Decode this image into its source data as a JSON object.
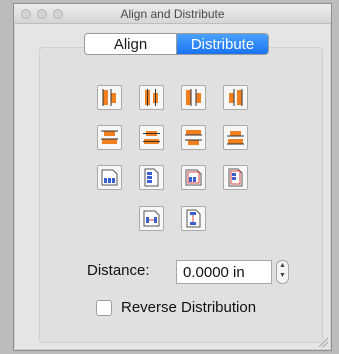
{
  "window": {
    "title": "Align and Distribute"
  },
  "tabs": [
    {
      "label": "Align",
      "active": false
    },
    {
      "label": "Distribute",
      "active": true
    }
  ],
  "distance": {
    "label": "Distance:",
    "value": "0.0000 in"
  },
  "reverse": {
    "label": "Reverse Distribution",
    "checked": false
  },
  "colors": {
    "accent": "#1973f5",
    "orange": "#f08020",
    "blue": "#3a5fd0",
    "red": "#d24040"
  }
}
